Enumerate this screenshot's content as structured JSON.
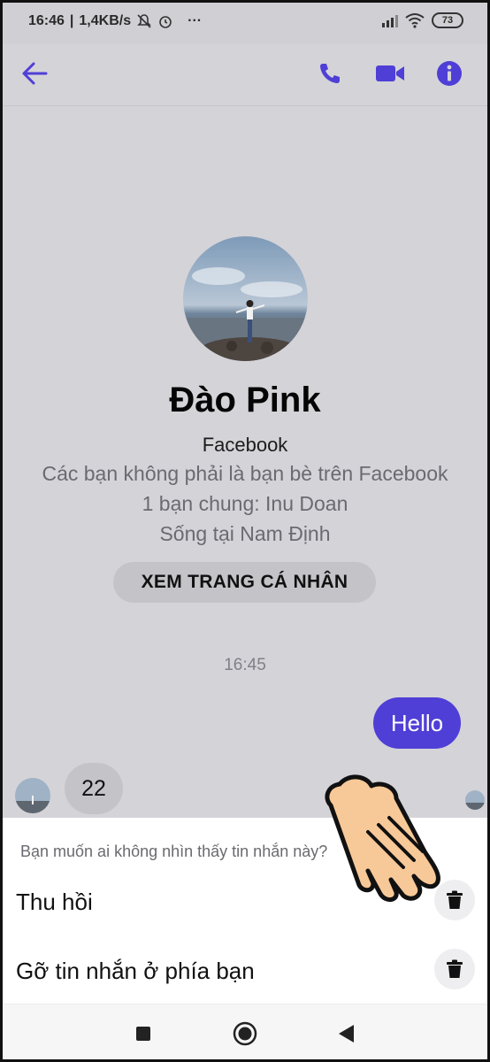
{
  "status_bar": {
    "time": "16:46",
    "speed": "1,4KB/s",
    "battery": "73",
    "dots": "···"
  },
  "app_bar": {
    "back": "back-arrow-icon",
    "call": "phone-icon",
    "video": "video-camera-icon",
    "info": "info-icon",
    "accent": "#4f3fd6"
  },
  "profile": {
    "name": "Đào Pink",
    "source": "Facebook",
    "line1": "Các bạn không phải là bạn bè trên Facebook",
    "line2": "1 bạn chung: Inu Doan",
    "line3": "Sống tại Nam Định",
    "view_profile_button": "XEM TRANG CÁ NHÂN"
  },
  "messages": {
    "timestamp": "16:45",
    "outgoing": "Hello",
    "incoming": "22"
  },
  "sheet": {
    "prompt": "Bạn muốn ai không nhìn thấy tin nhắn này?",
    "options": [
      {
        "label": "Thu hồi",
        "icon": "trash-icon"
      },
      {
        "label": "Gỡ tin nhắn ở phía bạn",
        "icon": "trash-icon"
      }
    ]
  },
  "nav_bar": {
    "recent": "square-icon",
    "home": "circle-icon",
    "back": "triangle-back-icon"
  }
}
